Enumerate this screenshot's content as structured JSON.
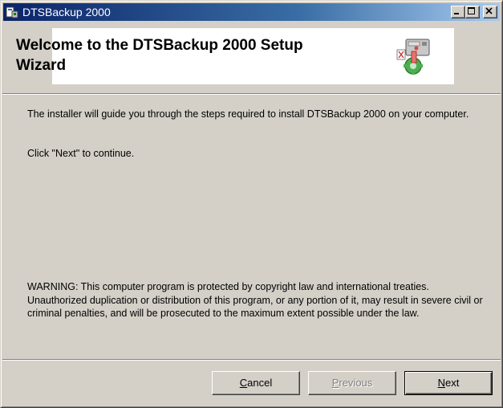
{
  "window": {
    "title": "DTSBackup 2000",
    "icon": "installer-icon",
    "controls": [
      "minimize-icon",
      "maximize-icon",
      "close-icon"
    ]
  },
  "banner": {
    "heading": "Welcome to the DTSBackup 2000 Setup Wizard",
    "icon": "setup-wizard-icon"
  },
  "body": {
    "intro": "The installer will guide you through the steps required to install DTSBackup 2000 on your computer.",
    "continue_hint": "Click \"Next\" to continue.",
    "warning": "WARNING: This computer program is protected by copyright law and international treaties. Unauthorized duplication or distribution of this program, or any portion of it, may result in severe civil or criminal penalties, and will be prosecuted to the maximum extent possible under the law."
  },
  "buttons": {
    "cancel": {
      "accel": "C",
      "rest": "ancel",
      "enabled": true
    },
    "previous": {
      "accel": "P",
      "rest": "revious",
      "enabled": false
    },
    "next": {
      "accel": "N",
      "rest": "ext",
      "enabled": true,
      "default": true
    }
  },
  "colors": {
    "titlebar_start": "#0a246a",
    "titlebar_end": "#a6caf0",
    "face": "#d4d0c8"
  }
}
